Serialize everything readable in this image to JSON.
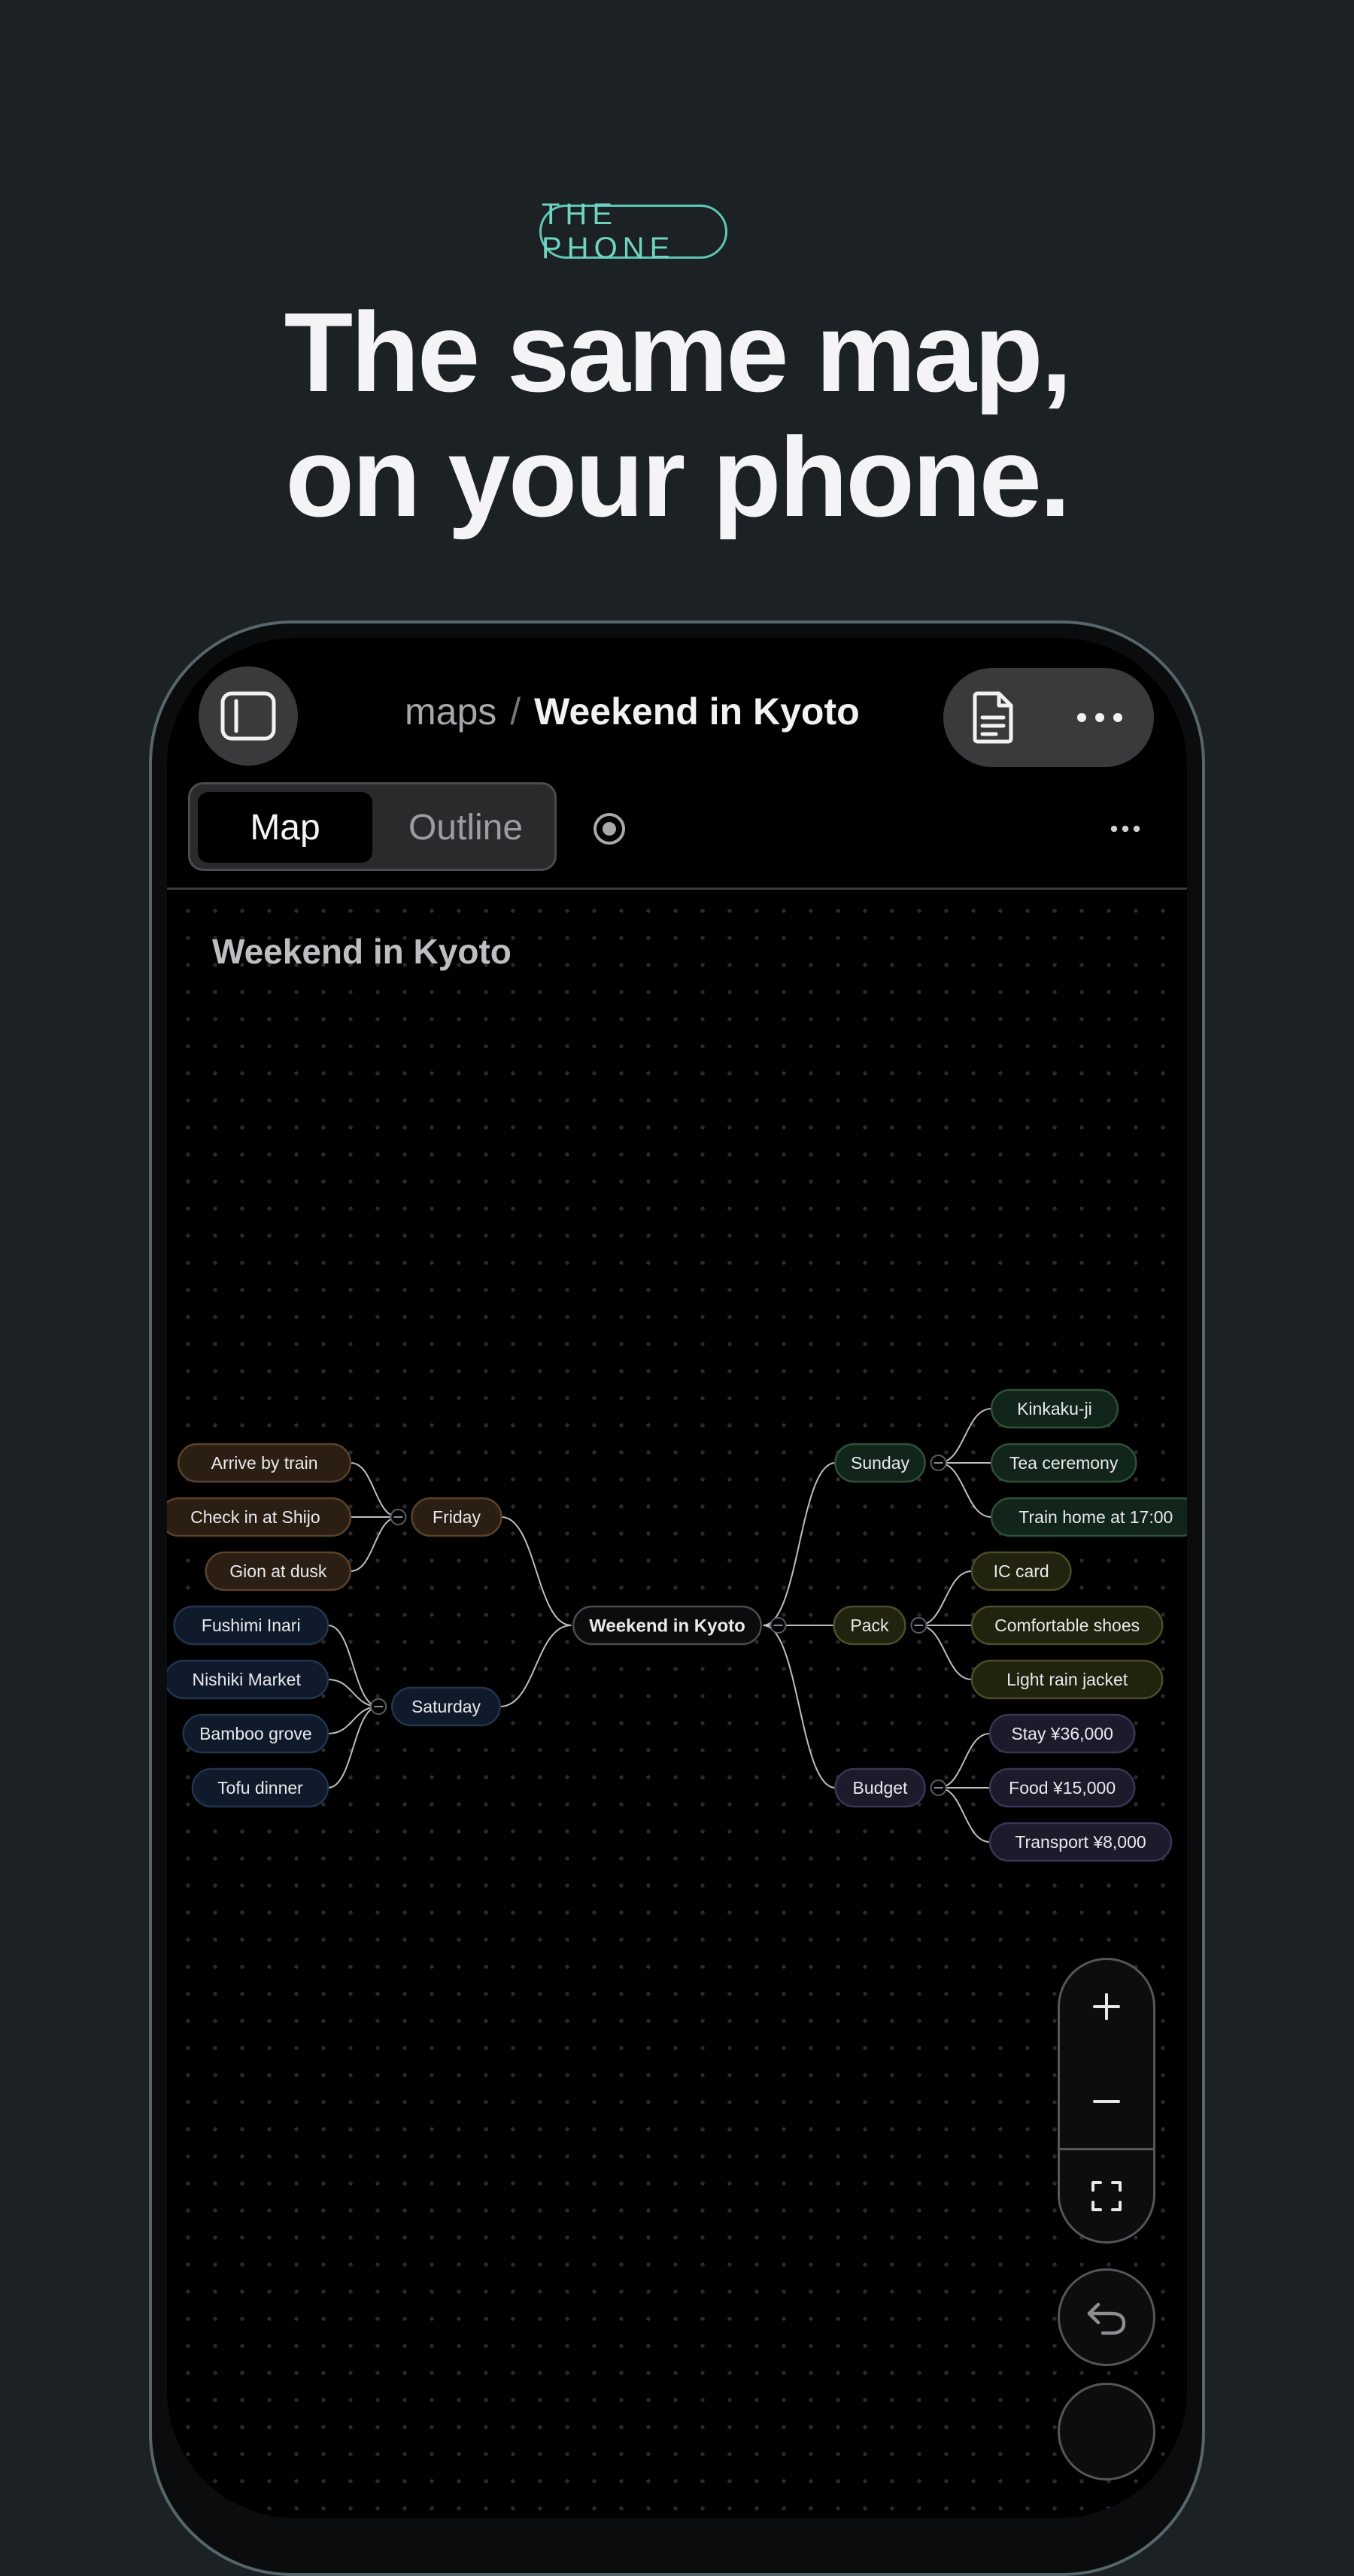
{
  "hero": {
    "tag": "THE PHONE",
    "headline_line1": "The same map,",
    "headline_line2": "on your phone."
  },
  "app": {
    "breadcrumb": {
      "parent": "maps",
      "separator": "/",
      "current": "Weekend in Kyoto"
    },
    "icons": {
      "sidebar": "sidebar-icon",
      "document": "document-icon",
      "more": "more-icon",
      "focus": "focus-icon",
      "zoom_in": "plus-icon",
      "zoom_out": "minus-icon",
      "fit": "fit-screen-icon",
      "undo": "undo-icon"
    },
    "tabs": [
      {
        "label": "Map",
        "active": true
      },
      {
        "label": "Outline",
        "active": false
      }
    ],
    "canvas_title": "Weekend in Kyoto"
  },
  "mindmap": {
    "root": "Weekend in Kyoto",
    "branches": [
      {
        "id": "friday",
        "label": "Friday",
        "tone": "brown",
        "children": [
          "Arrive by train",
          "Check in at Shijo",
          "Gion at dusk"
        ]
      },
      {
        "id": "saturday",
        "label": "Saturday",
        "tone": "blue",
        "children": [
          "Fushimi Inari",
          "Nishiki Market",
          "Bamboo grove",
          "Tofu dinner"
        ]
      },
      {
        "id": "sunday",
        "label": "Sunday",
        "tone": "green",
        "children": [
          "Kinkaku-ji",
          "Tea ceremony",
          "Train home at 17:00"
        ]
      },
      {
        "id": "pack",
        "label": "Pack",
        "tone": "olive",
        "children": [
          "IC card",
          "Comfortable shoes",
          "Light rain jacket"
        ]
      },
      {
        "id": "budget",
        "label": "Budget",
        "tone": "purple",
        "children": [
          "Stay ¥36,000",
          "Food ¥15,000",
          "Transport ¥8,000"
        ]
      }
    ]
  },
  "colors": {
    "background": "#1b2124",
    "accent": "#6fd3c2",
    "brown": "#2b1f14",
    "blue": "#0f1a2a",
    "green": "#12251a",
    "olive": "#22230f",
    "purple": "#1d1a2c"
  }
}
